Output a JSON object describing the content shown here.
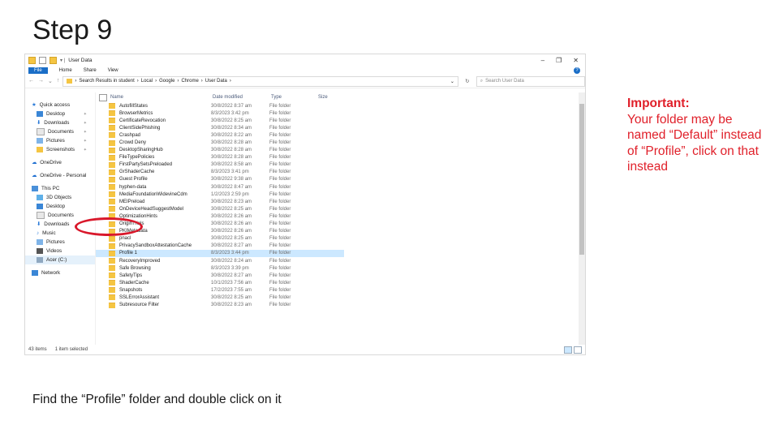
{
  "slide": {
    "title": "Step 9",
    "instruction": "Find the “Profile” folder and double click on it",
    "note_heading": "Important:",
    "note_body": "Your folder may be named “Default” instead of “Profile”, click on that instead",
    "accent_color": "#e0202a"
  },
  "window": {
    "title": "User Data",
    "controls": [
      "–",
      "❐",
      "✕"
    ],
    "ribbon_tabs": [
      "File",
      "Home",
      "Share",
      "View"
    ],
    "address": {
      "crumbs": [
        "Search Results in student",
        "Local",
        "Google",
        "Chrome",
        "User Data"
      ],
      "search_placeholder": "Search User Data"
    },
    "nav": {
      "quick_access": "Quick access",
      "quick_items": [
        "Desktop",
        "Downloads",
        "Documents",
        "Pictures",
        "Screenshots"
      ],
      "onedrive": "OneDrive",
      "onedrive_personal": "OneDrive - Personal",
      "this_pc": "This PC",
      "pc_items": [
        "3D Objects",
        "Desktop",
        "Documents",
        "Downloads",
        "Music",
        "Pictures",
        "Videos",
        "Acer (C:)"
      ],
      "network": "Network"
    },
    "columns": [
      "Name",
      "Date modified",
      "Type",
      "Size"
    ],
    "files": [
      {
        "name": "AutofillStates",
        "date": "30/8/2022 8:37 am",
        "type": "File folder"
      },
      {
        "name": "BrowserMetrics",
        "date": "8/3/2023 3:42 pm",
        "type": "File folder"
      },
      {
        "name": "CertificateRevocation",
        "date": "30/8/2022 8:25 am",
        "type": "File folder"
      },
      {
        "name": "ClientSidePhishing",
        "date": "30/8/2022 8:34 am",
        "type": "File folder"
      },
      {
        "name": "Crashpad",
        "date": "30/8/2022 8:22 am",
        "type": "File folder"
      },
      {
        "name": "Crowd Deny",
        "date": "30/8/2022 8:28 am",
        "type": "File folder"
      },
      {
        "name": "DesktopSharingHub",
        "date": "30/8/2022 8:28 am",
        "type": "File folder"
      },
      {
        "name": "FileTypePolicies",
        "date": "30/8/2022 8:28 am",
        "type": "File folder"
      },
      {
        "name": "FirstPartySetsPreloaded",
        "date": "30/8/2022 8:58 am",
        "type": "File folder"
      },
      {
        "name": "GrShaderCache",
        "date": "8/3/2023 3:41 pm",
        "type": "File folder"
      },
      {
        "name": "Guest Profile",
        "date": "30/8/2022 9:38 am",
        "type": "File folder"
      },
      {
        "name": "hyphen-data",
        "date": "30/8/2022 8:47 am",
        "type": "File folder"
      },
      {
        "name": "MediaFoundationWidevineCdm",
        "date": "1/2/2023 2:59 pm",
        "type": "File folder"
      },
      {
        "name": "MEIPreload",
        "date": "30/8/2022 8:23 am",
        "type": "File folder"
      },
      {
        "name": "OnDeviceHeadSuggestModel",
        "date": "30/8/2022 8:25 am",
        "type": "File folder"
      },
      {
        "name": "OptimizationHints",
        "date": "30/8/2022 8:26 am",
        "type": "File folder"
      },
      {
        "name": "OriginTrials",
        "date": "30/8/2022 8:26 am",
        "type": "File folder"
      },
      {
        "name": "PKIMetadata",
        "date": "30/8/2022 8:26 am",
        "type": "File folder"
      },
      {
        "name": "pnacl",
        "date": "30/8/2022 8:25 am",
        "type": "File folder"
      },
      {
        "name": "PrivacySandboxAttestationCache",
        "date": "30/8/2022 8:27 am",
        "type": "File folder"
      },
      {
        "name": "Profile 1",
        "date": "8/3/2023 3:44 pm",
        "type": "File folder"
      },
      {
        "name": "RecoveryImproved",
        "date": "30/8/2022 8:24 am",
        "type": "File folder"
      },
      {
        "name": "Safe Browsing",
        "date": "8/3/2023 3:39 pm",
        "type": "File folder"
      },
      {
        "name": "SafetyTips",
        "date": "30/8/2022 8:27 am",
        "type": "File folder"
      },
      {
        "name": "ShaderCache",
        "date": "10/1/2023 7:56 am",
        "type": "File folder"
      },
      {
        "name": "Snapshots",
        "date": "17/2/2023 7:55 am",
        "type": "File folder"
      },
      {
        "name": "SSLErrorAssistant",
        "date": "30/8/2022 8:25 am",
        "type": "File folder"
      },
      {
        "name": "Subresource Filter",
        "date": "30/8/2022 8:23 am",
        "type": "File folder"
      }
    ],
    "selected_index": 20,
    "status": {
      "items": "43 items",
      "selected": "1 item selected"
    }
  }
}
